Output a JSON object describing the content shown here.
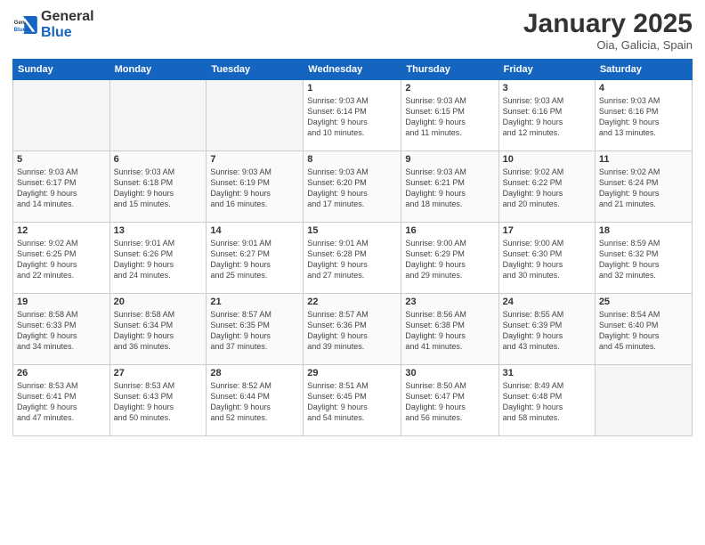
{
  "header": {
    "logo_general": "General",
    "logo_blue": "Blue",
    "month": "January 2025",
    "location": "Oia, Galicia, Spain"
  },
  "days_of_week": [
    "Sunday",
    "Monday",
    "Tuesday",
    "Wednesday",
    "Thursday",
    "Friday",
    "Saturday"
  ],
  "weeks": [
    [
      {
        "day": "",
        "info": ""
      },
      {
        "day": "",
        "info": ""
      },
      {
        "day": "",
        "info": ""
      },
      {
        "day": "1",
        "info": "Sunrise: 9:03 AM\nSunset: 6:14 PM\nDaylight: 9 hours\nand 10 minutes."
      },
      {
        "day": "2",
        "info": "Sunrise: 9:03 AM\nSunset: 6:15 PM\nDaylight: 9 hours\nand 11 minutes."
      },
      {
        "day": "3",
        "info": "Sunrise: 9:03 AM\nSunset: 6:16 PM\nDaylight: 9 hours\nand 12 minutes."
      },
      {
        "day": "4",
        "info": "Sunrise: 9:03 AM\nSunset: 6:16 PM\nDaylight: 9 hours\nand 13 minutes."
      }
    ],
    [
      {
        "day": "5",
        "info": "Sunrise: 9:03 AM\nSunset: 6:17 PM\nDaylight: 9 hours\nand 14 minutes."
      },
      {
        "day": "6",
        "info": "Sunrise: 9:03 AM\nSunset: 6:18 PM\nDaylight: 9 hours\nand 15 minutes."
      },
      {
        "day": "7",
        "info": "Sunrise: 9:03 AM\nSunset: 6:19 PM\nDaylight: 9 hours\nand 16 minutes."
      },
      {
        "day": "8",
        "info": "Sunrise: 9:03 AM\nSunset: 6:20 PM\nDaylight: 9 hours\nand 17 minutes."
      },
      {
        "day": "9",
        "info": "Sunrise: 9:03 AM\nSunset: 6:21 PM\nDaylight: 9 hours\nand 18 minutes."
      },
      {
        "day": "10",
        "info": "Sunrise: 9:02 AM\nSunset: 6:22 PM\nDaylight: 9 hours\nand 20 minutes."
      },
      {
        "day": "11",
        "info": "Sunrise: 9:02 AM\nSunset: 6:24 PM\nDaylight: 9 hours\nand 21 minutes."
      }
    ],
    [
      {
        "day": "12",
        "info": "Sunrise: 9:02 AM\nSunset: 6:25 PM\nDaylight: 9 hours\nand 22 minutes."
      },
      {
        "day": "13",
        "info": "Sunrise: 9:01 AM\nSunset: 6:26 PM\nDaylight: 9 hours\nand 24 minutes."
      },
      {
        "day": "14",
        "info": "Sunrise: 9:01 AM\nSunset: 6:27 PM\nDaylight: 9 hours\nand 25 minutes."
      },
      {
        "day": "15",
        "info": "Sunrise: 9:01 AM\nSunset: 6:28 PM\nDaylight: 9 hours\nand 27 minutes."
      },
      {
        "day": "16",
        "info": "Sunrise: 9:00 AM\nSunset: 6:29 PM\nDaylight: 9 hours\nand 29 minutes."
      },
      {
        "day": "17",
        "info": "Sunrise: 9:00 AM\nSunset: 6:30 PM\nDaylight: 9 hours\nand 30 minutes."
      },
      {
        "day": "18",
        "info": "Sunrise: 8:59 AM\nSunset: 6:32 PM\nDaylight: 9 hours\nand 32 minutes."
      }
    ],
    [
      {
        "day": "19",
        "info": "Sunrise: 8:58 AM\nSunset: 6:33 PM\nDaylight: 9 hours\nand 34 minutes."
      },
      {
        "day": "20",
        "info": "Sunrise: 8:58 AM\nSunset: 6:34 PM\nDaylight: 9 hours\nand 36 minutes."
      },
      {
        "day": "21",
        "info": "Sunrise: 8:57 AM\nSunset: 6:35 PM\nDaylight: 9 hours\nand 37 minutes."
      },
      {
        "day": "22",
        "info": "Sunrise: 8:57 AM\nSunset: 6:36 PM\nDaylight: 9 hours\nand 39 minutes."
      },
      {
        "day": "23",
        "info": "Sunrise: 8:56 AM\nSunset: 6:38 PM\nDaylight: 9 hours\nand 41 minutes."
      },
      {
        "day": "24",
        "info": "Sunrise: 8:55 AM\nSunset: 6:39 PM\nDaylight: 9 hours\nand 43 minutes."
      },
      {
        "day": "25",
        "info": "Sunrise: 8:54 AM\nSunset: 6:40 PM\nDaylight: 9 hours\nand 45 minutes."
      }
    ],
    [
      {
        "day": "26",
        "info": "Sunrise: 8:53 AM\nSunset: 6:41 PM\nDaylight: 9 hours\nand 47 minutes."
      },
      {
        "day": "27",
        "info": "Sunrise: 8:53 AM\nSunset: 6:43 PM\nDaylight: 9 hours\nand 50 minutes."
      },
      {
        "day": "28",
        "info": "Sunrise: 8:52 AM\nSunset: 6:44 PM\nDaylight: 9 hours\nand 52 minutes."
      },
      {
        "day": "29",
        "info": "Sunrise: 8:51 AM\nSunset: 6:45 PM\nDaylight: 9 hours\nand 54 minutes."
      },
      {
        "day": "30",
        "info": "Sunrise: 8:50 AM\nSunset: 6:47 PM\nDaylight: 9 hours\nand 56 minutes."
      },
      {
        "day": "31",
        "info": "Sunrise: 8:49 AM\nSunset: 6:48 PM\nDaylight: 9 hours\nand 58 minutes."
      },
      {
        "day": "",
        "info": ""
      }
    ]
  ]
}
